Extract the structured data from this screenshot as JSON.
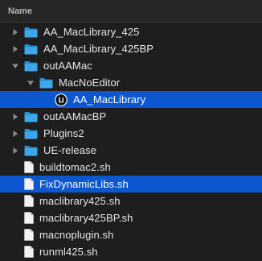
{
  "column": {
    "name_header": "Name"
  },
  "colors": {
    "background": "#1e1e1e",
    "selection": "#0a57d0",
    "folder": "#1f8fd6",
    "document": "#f2f2f2",
    "disclosure": "#8a8a8a"
  },
  "rows": [
    {
      "label": "AA_MacLibrary_425",
      "type": "folder",
      "icon": "folder-icon",
      "disclosure": "collapsed",
      "depth": 0,
      "selected": false
    },
    {
      "label": "AA_MacLibrary_425BP",
      "type": "folder",
      "icon": "folder-icon",
      "disclosure": "collapsed",
      "depth": 0,
      "selected": false
    },
    {
      "label": "outAAMac",
      "type": "folder",
      "icon": "folder-icon",
      "disclosure": "expanded",
      "depth": 0,
      "selected": false
    },
    {
      "label": "MacNoEditor",
      "type": "folder",
      "icon": "folder-icon",
      "disclosure": "expanded",
      "depth": 1,
      "selected": false
    },
    {
      "label": "AA_MacLibrary",
      "type": "app",
      "icon": "unreal-engine-icon",
      "disclosure": "none",
      "depth": 2,
      "selected": true
    },
    {
      "label": "outAAMacBP",
      "type": "folder",
      "icon": "folder-icon",
      "disclosure": "collapsed",
      "depth": 0,
      "selected": false
    },
    {
      "label": "Plugins2",
      "type": "folder",
      "icon": "folder-icon",
      "disclosure": "collapsed",
      "depth": 0,
      "selected": false
    },
    {
      "label": "UE-release",
      "type": "folder",
      "icon": "folder-icon",
      "disclosure": "collapsed",
      "depth": 0,
      "selected": false
    },
    {
      "label": "buildtomac2.sh",
      "type": "file",
      "icon": "document-icon",
      "disclosure": "none",
      "depth": 0,
      "selected": false
    },
    {
      "label": "FixDynamicLibs.sh",
      "type": "file",
      "icon": "document-icon",
      "disclosure": "none",
      "depth": 0,
      "selected": true
    },
    {
      "label": "maclibrary425.sh",
      "type": "file",
      "icon": "document-icon",
      "disclosure": "none",
      "depth": 0,
      "selected": false
    },
    {
      "label": "maclibrary425BP.sh",
      "type": "file",
      "icon": "document-icon",
      "disclosure": "none",
      "depth": 0,
      "selected": false
    },
    {
      "label": "macnoplugin.sh",
      "type": "file",
      "icon": "document-icon",
      "disclosure": "none",
      "depth": 0,
      "selected": false
    },
    {
      "label": "runml425.sh",
      "type": "file",
      "icon": "document-icon",
      "disclosure": "none",
      "depth": 0,
      "selected": false
    }
  ]
}
